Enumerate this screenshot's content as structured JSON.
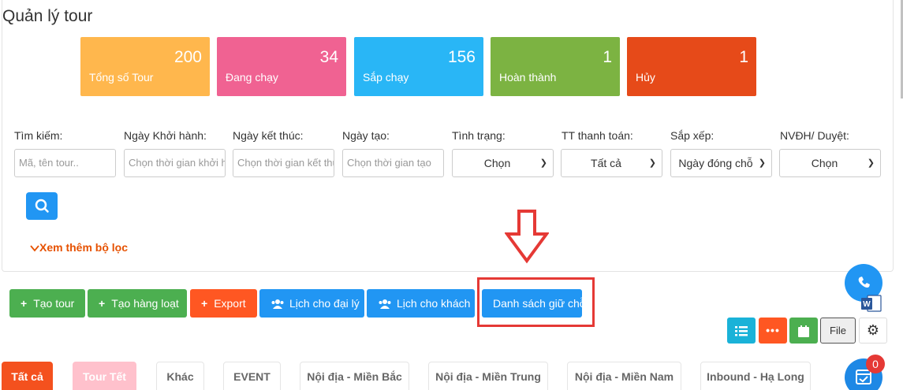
{
  "page_title": "Quản lý tour",
  "stats": [
    {
      "value": "200",
      "label": "Tổng số Tour",
      "color": "#ffb74d"
    },
    {
      "value": "34",
      "label": "Đang chạy",
      "color": "#f06292"
    },
    {
      "value": "156",
      "label": "Sắp chạy",
      "color": "#29b6f6"
    },
    {
      "value": "1",
      "label": "Hoàn thành",
      "color": "#7cb342"
    },
    {
      "value": "1",
      "label": "Hủy",
      "color": "#e64a19"
    }
  ],
  "filters": {
    "search": {
      "label": "Tìm kiếm:",
      "placeholder": "Mã, tên tour.."
    },
    "departure": {
      "label": "Ngày Khởi hành:",
      "placeholder": "Chọn thời gian khởi hành"
    },
    "end": {
      "label": "Ngày kết thúc:",
      "placeholder": "Chọn thời gian kết thúc"
    },
    "created": {
      "label": "Ngày tạo:",
      "placeholder": "Chọn thời gian tạo"
    },
    "status": {
      "label": "Tình trạng:",
      "value": "Chọn"
    },
    "payment": {
      "label": "TT thanh toán:",
      "value": "Tất cả"
    },
    "sort": {
      "label": "Sắp xếp:",
      "value": "Ngày đóng chỗ"
    },
    "approval": {
      "label": "NVĐH/ Duyệt:",
      "value": "Chọn"
    }
  },
  "more_filters": "Xem thêm bộ lọc",
  "actions": {
    "create_tour": "Tạo tour",
    "bulk_create": "Tạo hàng loạt",
    "export": "Export",
    "agent_schedule": "Lịch cho đại lý",
    "customer_schedule": "Lịch cho khách",
    "hold_list": "Danh sách giữ chỗ"
  },
  "view": {
    "file": "File"
  },
  "tabs": [
    "Tất cả",
    "Tour Tết",
    "Khác",
    "EVENT",
    "Nội địa - Miền Bắc",
    "Nội địa - Miền Trung",
    "Nội địa - Miền Nam",
    "Inbound - Hạ Long"
  ],
  "notification_count": "0",
  "colors": {
    "green": "#4caf50",
    "orange": "#ff5722",
    "blue": "#2196f3",
    "teal": "#1ab2d8",
    "highlight": "#e53935"
  }
}
